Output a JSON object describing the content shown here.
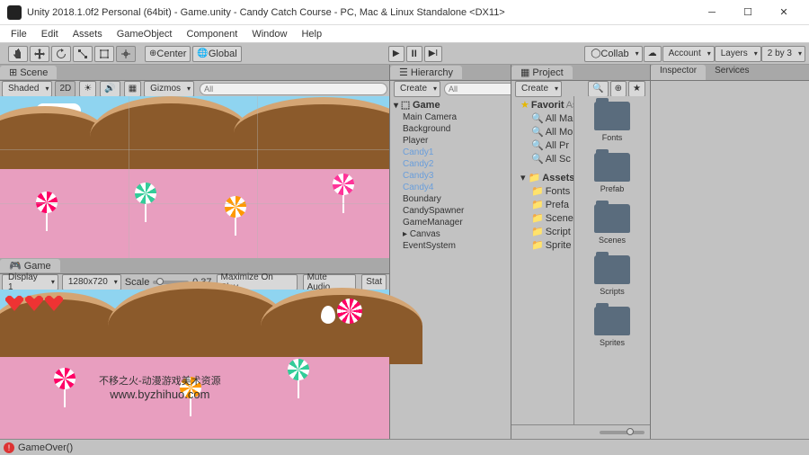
{
  "title": "Unity 2018.1.0f2 Personal (64bit) - Game.unity - Candy Catch Course - PC, Mac & Linux Standalone <DX11>",
  "menu": [
    "File",
    "Edit",
    "Assets",
    "GameObject",
    "Component",
    "Window",
    "Help"
  ],
  "toolbar": {
    "pivot": "Center",
    "handle": "Global",
    "collab": "Collab",
    "account": "Account",
    "layers": "Layers",
    "layout": "2 by 3"
  },
  "scene": {
    "tab": "Scene",
    "shading": "Shaded",
    "mode2d": "2D",
    "gizmos": "Gizmos",
    "search": "All"
  },
  "game": {
    "tab": "Game",
    "display": "Display 1",
    "resolution": "1280x720",
    "scale_label": "Scale",
    "scale_value": "0.37",
    "maximize": "Maximize On Play",
    "mute": "Mute Audio",
    "stats": "Stat"
  },
  "hierarchy": {
    "tab": "Hierarchy",
    "create": "Create",
    "search": "All",
    "root": "Game",
    "nodes": [
      "Main Camera",
      "Background",
      "Player",
      "Candy1",
      "Candy2",
      "Candy3",
      "Candy4",
      "Boundary",
      "CandySpawner",
      "GameManager",
      "Canvas",
      "EventSystem"
    ],
    "selected_idx": [
      3,
      4,
      5,
      6
    ],
    "expandable_idx": [
      10
    ]
  },
  "project": {
    "tab": "Project",
    "create": "Create",
    "fav": "Favorit",
    "fav_h": "Assets",
    "favitems": [
      "All Ma",
      "All Mo",
      "All Pr",
      "All Sc"
    ],
    "assets": "Assets",
    "assetitems": [
      "Fonts",
      "Prefa",
      "Scene",
      "Script",
      "Sprite"
    ],
    "folders": [
      "Fonts",
      "Prefab",
      "Scenes",
      "Scripts",
      "Sprites"
    ]
  },
  "inspector": {
    "tab1": "Inspector",
    "tab2": "Services"
  },
  "status": "GameOver()",
  "watermark": {
    "line1": "不移之火-动漫游戏美术资源",
    "line2": "www.byzhihuo.com"
  }
}
